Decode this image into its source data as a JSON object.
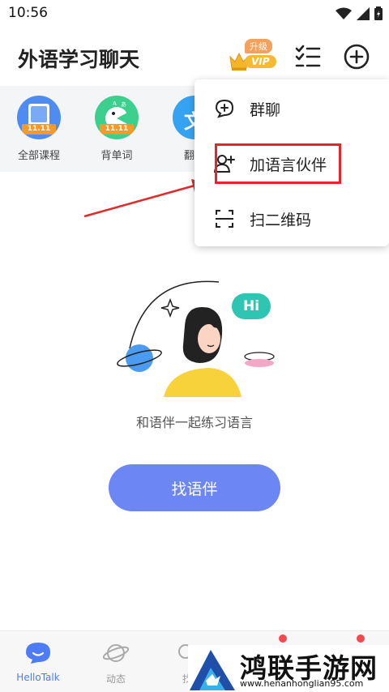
{
  "status_bar": {
    "time": "10:56"
  },
  "header": {
    "title": "外语学习聊天",
    "vip_upgrade": "升级",
    "vip_label": "VIP"
  },
  "courses": [
    {
      "label": "全部课程",
      "badge": "11.11",
      "color": "#4e8cf1"
    },
    {
      "label": "背单词",
      "badge": "11.11",
      "color": "#3dcf8e"
    },
    {
      "label": "翻译",
      "icon_char": "文",
      "color": "#36a3f2"
    }
  ],
  "empty_state": {
    "bubble_text": "Hi",
    "message": "和语伴一起练习语言",
    "button": "找语伴"
  },
  "menu": {
    "items": [
      {
        "label": "群聊",
        "icon": "group-chat-icon"
      },
      {
        "label": "加语言伙伴",
        "icon": "add-partner-icon"
      },
      {
        "label": "扫二维码",
        "icon": "scan-qr-icon"
      }
    ]
  },
  "bottom_nav": [
    {
      "label": "HelloTalk",
      "icon": "hellotalk-chat-icon",
      "active": true
    },
    {
      "label": "动态",
      "icon": "planet-icon",
      "active": false
    },
    {
      "label": "找",
      "icon": "find-icon",
      "active": false
    }
  ],
  "watermark": {
    "title": "鸿联手游网",
    "url": "www.henanhonglian95.com"
  },
  "colors": {
    "accent": "#6c86f4",
    "active_nav": "#4e7cf6",
    "highlight": "#e5252a",
    "vip": "#f7b933"
  }
}
